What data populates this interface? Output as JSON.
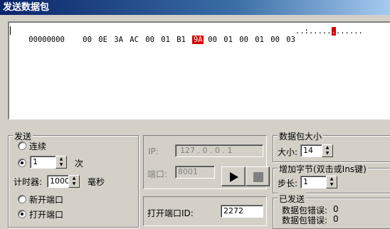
{
  "window": {
    "title": "发送数据包"
  },
  "hex": {
    "offset": "00000000",
    "bytes": [
      "00",
      "0E",
      "3A",
      "AC",
      "00",
      "01",
      "B1",
      "9A",
      "00",
      "01",
      "00",
      "01",
      "00",
      "03"
    ],
    "selected_index": 7,
    "ascii_before": "..:.....",
    "ascii_selected": ".",
    "ascii_after": "......"
  },
  "send_group": {
    "title": "发送",
    "continuous_label": "连续",
    "times_value": "1",
    "times_unit": "次",
    "timer_label": "计时器:",
    "timer_value": "1000",
    "timer_unit": "毫秒",
    "new_port_label": "新开端口",
    "open_port_label": "打开端口",
    "selected_mode": "times",
    "selected_port_mode": "open"
  },
  "connection": {
    "ip_label": "IP:",
    "ip_value": "127 . 0 . 0 . 1",
    "port_label": "端口:",
    "port_value": "8001",
    "open_port_id_label": "打开端口ID:",
    "open_port_id_value": "2272"
  },
  "packet_size": {
    "title": "数据包大小",
    "size_label": "大小:",
    "size_value": "14"
  },
  "increment": {
    "title": "增加字节(双击或Ins键)",
    "step_label": "步长:",
    "step_value": "1"
  },
  "sent": {
    "title": "已发送",
    "error_label_1": "数据包错误:",
    "error_value_1": "0",
    "error_label_2": "数据包错误:",
    "error_value_2": "0"
  },
  "icons": {
    "play": "play-icon",
    "stop": "stop-icon"
  },
  "colors": {
    "title_bar": "#0a246a",
    "selection": "#d40000",
    "face": "#d4d0c8"
  }
}
